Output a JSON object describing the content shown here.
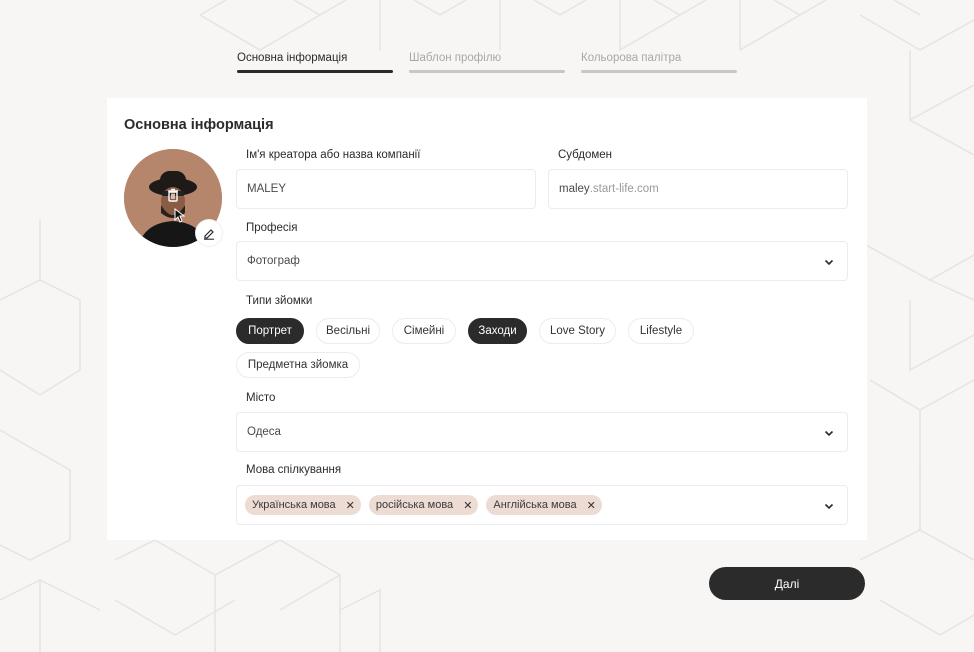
{
  "stepper": {
    "steps": [
      {
        "label": "Основна інформація"
      },
      {
        "label": "Шаблон профілю"
      },
      {
        "label": "Кольорова палітра"
      }
    ]
  },
  "form": {
    "title": "Основна інформація",
    "creator_name": {
      "label": "Ім'я креатора або назва компанії",
      "value": "MALEY"
    },
    "subdomain": {
      "label": "Субдомен",
      "value": "maley",
      "suffix": ".start-life.com"
    },
    "profession": {
      "label": "Професія",
      "value": "Фотограф"
    },
    "shoot_types": {
      "label": "Типи зйомки",
      "options": [
        {
          "label": "Портрет",
          "selected": true
        },
        {
          "label": "Весільні",
          "selected": false
        },
        {
          "label": "Сімейні",
          "selected": false
        },
        {
          "label": "Заходи",
          "selected": true
        },
        {
          "label": "Love Story",
          "selected": false
        },
        {
          "label": "Lifestyle",
          "selected": false
        },
        {
          "label": "Предметна зйомка",
          "selected": false
        }
      ]
    },
    "city": {
      "label": "Місто",
      "value": "Одеса"
    },
    "languages": {
      "label": "Мова спілкування",
      "tags": [
        {
          "label": "Українська мова"
        },
        {
          "label": "російська мова"
        },
        {
          "label": "Англійська мова"
        }
      ]
    }
  },
  "actions": {
    "next_label": "Далі"
  },
  "colors": {
    "dark": "#2b2b2b",
    "tag_bg": "#ecdcd3",
    "avatar_bg": "#b5866c"
  }
}
